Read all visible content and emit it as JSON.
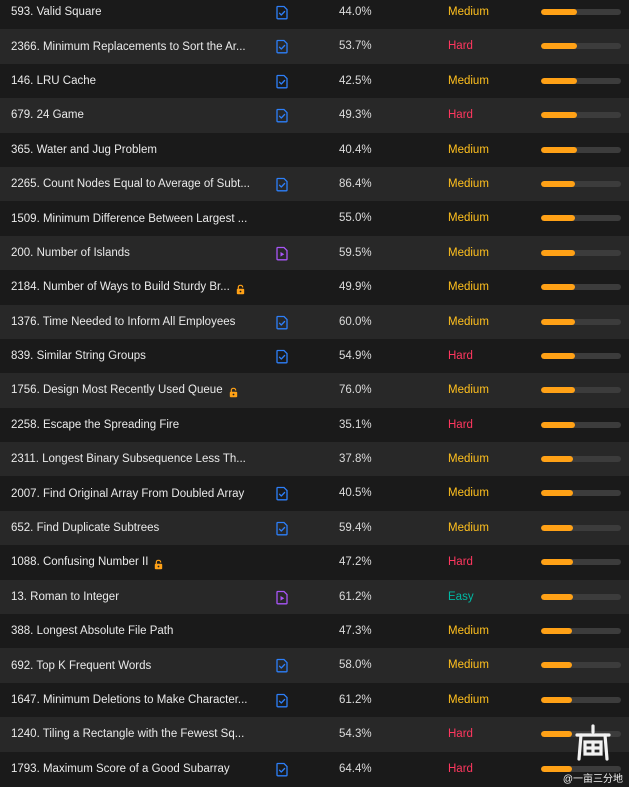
{
  "colors": {
    "Easy": "#00b8a3",
    "Medium": "#ffc01e",
    "Hard": "#ff375f",
    "solution_blue": "#2d7ff9",
    "solution_purple": "#a855f7",
    "lock": "#ffa116",
    "frequency_bar": "#ffa116"
  },
  "problems": [
    {
      "title": "593. Valid Square",
      "solution": "article",
      "acceptance": "44.0%",
      "difficulty": "Medium",
      "frequency": 0.45
    },
    {
      "title": "2366. Minimum Replacements to Sort the Ar...",
      "solution": "article",
      "acceptance": "53.7%",
      "difficulty": "Hard",
      "frequency": 0.45
    },
    {
      "title": "146. LRU Cache",
      "solution": "article",
      "acceptance": "42.5%",
      "difficulty": "Medium",
      "frequency": 0.45
    },
    {
      "title": "679. 24 Game",
      "solution": "article",
      "acceptance": "49.3%",
      "difficulty": "Hard",
      "frequency": 0.45
    },
    {
      "title": "365. Water and Jug Problem",
      "solution": "none",
      "acceptance": "40.4%",
      "difficulty": "Medium",
      "frequency": 0.45
    },
    {
      "title": "2265. Count Nodes Equal to Average of Subt...",
      "solution": "article",
      "acceptance": "86.4%",
      "difficulty": "Medium",
      "frequency": 0.43
    },
    {
      "title": "1509. Minimum Difference Between Largest ...",
      "solution": "none",
      "acceptance": "55.0%",
      "difficulty": "Medium",
      "frequency": 0.43
    },
    {
      "title": "200. Number of Islands",
      "solution": "video",
      "acceptance": "59.5%",
      "difficulty": "Medium",
      "frequency": 0.43
    },
    {
      "title": "2184. Number of Ways to Build Sturdy Br...",
      "solution": "none",
      "locked": true,
      "acceptance": "49.9%",
      "difficulty": "Medium",
      "frequency": 0.43
    },
    {
      "title": "1376. Time Needed to Inform All Employees",
      "solution": "article",
      "acceptance": "60.0%",
      "difficulty": "Medium",
      "frequency": 0.42
    },
    {
      "title": "839. Similar String Groups",
      "solution": "article",
      "acceptance": "54.9%",
      "difficulty": "Hard",
      "frequency": 0.42
    },
    {
      "title": "1756. Design Most Recently Used Queue",
      "solution": "none",
      "locked": true,
      "acceptance": "76.0%",
      "difficulty": "Medium",
      "frequency": 0.42
    },
    {
      "title": "2258. Escape the Spreading Fire",
      "solution": "none",
      "acceptance": "35.1%",
      "difficulty": "Hard",
      "frequency": 0.42
    },
    {
      "title": "2311. Longest Binary Subsequence Less Th...",
      "solution": "none",
      "acceptance": "37.8%",
      "difficulty": "Medium",
      "frequency": 0.4
    },
    {
      "title": "2007. Find Original Array From Doubled Array",
      "solution": "article",
      "acceptance": "40.5%",
      "difficulty": "Medium",
      "frequency": 0.4
    },
    {
      "title": "652. Find Duplicate Subtrees",
      "solution": "article",
      "acceptance": "59.4%",
      "difficulty": "Medium",
      "frequency": 0.4
    },
    {
      "title": "1088. Confusing Number II",
      "solution": "none",
      "locked": true,
      "acceptance": "47.2%",
      "difficulty": "Hard",
      "frequency": 0.4
    },
    {
      "title": "13. Roman to Integer",
      "solution": "video",
      "acceptance": "61.2%",
      "difficulty": "Easy",
      "frequency": 0.4
    },
    {
      "title": "388. Longest Absolute File Path",
      "solution": "none",
      "acceptance": "47.3%",
      "difficulty": "Medium",
      "frequency": 0.39
    },
    {
      "title": "692. Top K Frequent Words",
      "solution": "article",
      "acceptance": "58.0%",
      "difficulty": "Medium",
      "frequency": 0.39
    },
    {
      "title": "1647. Minimum Deletions to Make Character...",
      "solution": "article",
      "acceptance": "61.2%",
      "difficulty": "Medium",
      "frequency": 0.39
    },
    {
      "title": "1240. Tiling a Rectangle with the Fewest Sq...",
      "solution": "none",
      "acceptance": "54.3%",
      "difficulty": "Hard",
      "frequency": 0.39
    },
    {
      "title": "1793. Maximum Score of a Good Subarray",
      "solution": "article",
      "acceptance": "64.4%",
      "difficulty": "Hard",
      "frequency": 0.39
    }
  ],
  "watermark": {
    "text": "@一亩三分地"
  }
}
